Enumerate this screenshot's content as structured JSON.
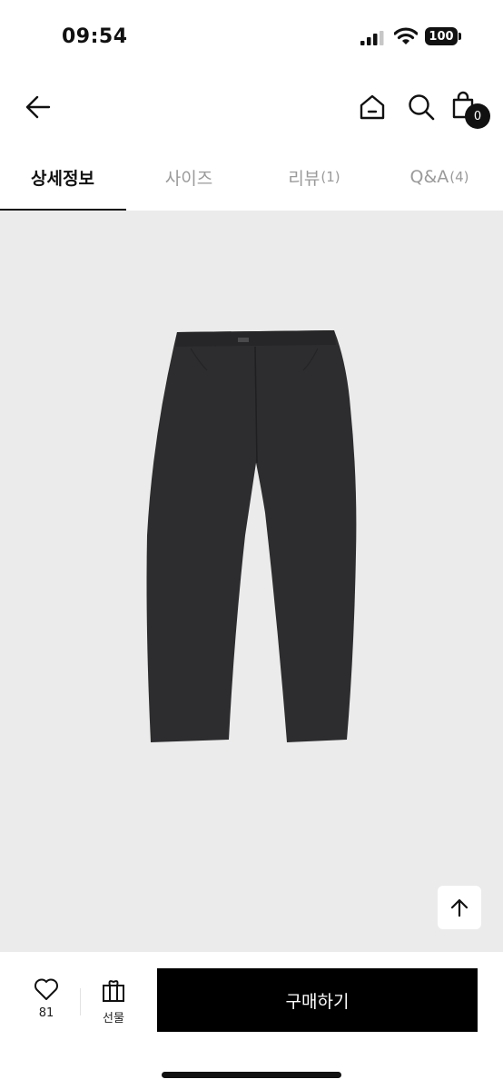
{
  "status_bar": {
    "time": "09:54",
    "battery": "100"
  },
  "header": {
    "back_icon": "arrow-left-icon",
    "home_icon": "home-icon",
    "search_icon": "search-icon",
    "cart_icon": "shopping-bag-icon",
    "cart_count": "0"
  },
  "tabs": [
    {
      "label": "상세정보",
      "count": ""
    },
    {
      "label": "사이즈",
      "count": ""
    },
    {
      "label": "리뷰",
      "count": "(1)"
    },
    {
      "label": "Q&A",
      "count": "(4)"
    }
  ],
  "product_image": {
    "background": "#ebebeb",
    "garment_color": "#2d2d2f"
  },
  "scroll_top": {
    "icon": "arrow-up-icon"
  },
  "bottom_bar": {
    "like_icon": "heart-icon",
    "like_count": "81",
    "gift_icon": "gift-icon",
    "gift_label": "선물",
    "buy_label": "구매하기"
  },
  "colors": {
    "accent": "#000000",
    "inactive_tab": "#9a9a9a"
  }
}
